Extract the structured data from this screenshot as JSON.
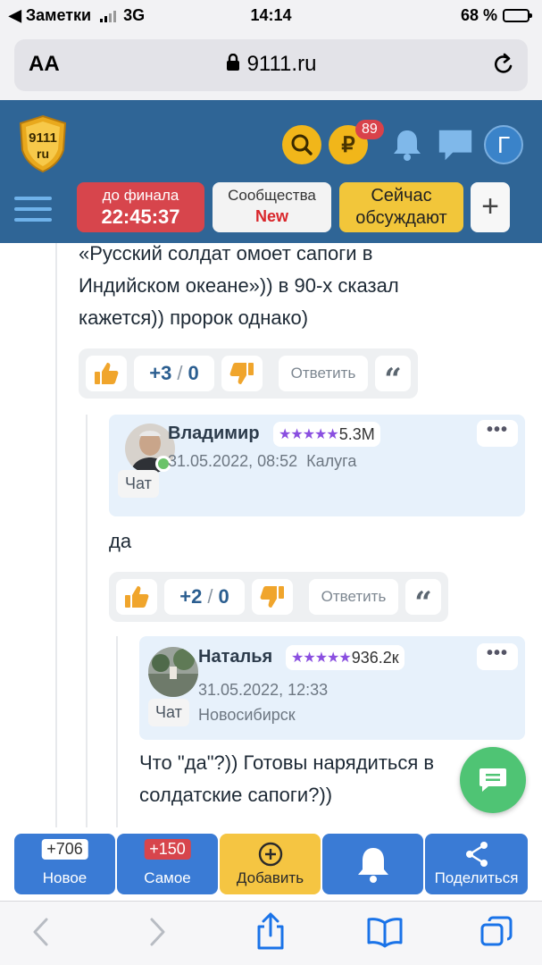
{
  "status": {
    "back_app": "◀ Заметки",
    "network": "3G",
    "time": "14:14",
    "battery": "68 %",
    "battery_level": 0.68
  },
  "browser": {
    "aa_label": "AA",
    "url": "9111.ru"
  },
  "site_header": {
    "logo_top": "9111",
    "logo_bottom": "ru",
    "balance_badge": "89",
    "avatar_letter": "Г",
    "final_line1": "до финала",
    "final_timer": "22:45:37",
    "communities_line1": "Сообщества",
    "communities_line2": "New",
    "now_line1": "Сейчас",
    "now_line2": "обсуждают",
    "plus": "+"
  },
  "thread": {
    "post_text_lines": [
      "«Русский солдат омоет сапоги в",
      "Индийском океане»)) в 90-х сказал",
      "кажется)) пророк однако)"
    ],
    "post_votes": {
      "plus": "+3",
      "minus": "0",
      "reply": "Ответить",
      "quote": "“"
    },
    "comments": [
      {
        "username": "Владимир",
        "stars": "★★★★★",
        "rating": "5.3M",
        "date": "31.05.2022, 08:52",
        "city": "Калуга",
        "chat_label": "Чат",
        "more": "•••",
        "text": "да",
        "votes": {
          "plus": "+2",
          "minus": "0",
          "reply": "Ответить",
          "quote": "“"
        }
      },
      {
        "username": "Наталья",
        "stars": "★★★★★",
        "rating": "936.2к",
        "date": "31.05.2022, 12:33",
        "city": "Новосибирск",
        "chat_label": "Чат",
        "more": "•••",
        "text_lines": [
          "Что \"да\"?)) Готовы нарядиться в",
          "солдатские сапоги?))"
        ]
      }
    ]
  },
  "bottom_nav": [
    {
      "count": "+706",
      "label": "Новое"
    },
    {
      "count": "+150",
      "label": "Самое"
    },
    {
      "label": "Добавить"
    },
    {
      "label": ""
    },
    {
      "label": "Поделиться"
    }
  ],
  "colors": {
    "site_header": "#2f6596",
    "accent_gold": "#f1b61a",
    "timer_red": "#d7454c",
    "nav_blue": "#3a7bd5",
    "fab_green": "#4fc474",
    "card_blue": "#e7f1fb"
  }
}
